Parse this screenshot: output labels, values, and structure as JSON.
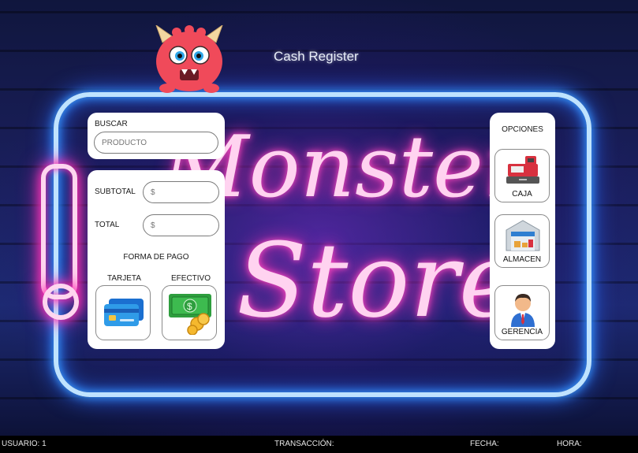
{
  "app": {
    "title": "Cash Register"
  },
  "background": {
    "neon_line1": "Monster",
    "neon_line2": "Store"
  },
  "search": {
    "label": "BUSCAR",
    "placeholder": "PRODUCTO",
    "value": ""
  },
  "payment": {
    "subtotal_label": "SUBTOTAL",
    "subtotal_placeholder": "$",
    "total_label": "TOTAL",
    "total_placeholder": "$",
    "method_label": "FORMA DE PAGO",
    "card_label": "TARJETA",
    "cash_label": "EFECTIVO"
  },
  "options": {
    "title": "OPCIONES",
    "items": [
      {
        "label": "CAJA",
        "icon": "cash-register-icon"
      },
      {
        "label": "ALMACEN",
        "icon": "warehouse-icon"
      },
      {
        "label": "GERENCIA",
        "icon": "manager-icon"
      }
    ]
  },
  "status_bar": {
    "user": "USUARIO: 1",
    "transaction": "TRANSACCIÓN:",
    "date": "FECHA:",
    "time": "HORA:"
  },
  "colors": {
    "neon_blue": "#3aa0ff",
    "neon_pink": "#ff2fb0",
    "panel_bg": "#ffffff",
    "status_bg": "#000000"
  }
}
